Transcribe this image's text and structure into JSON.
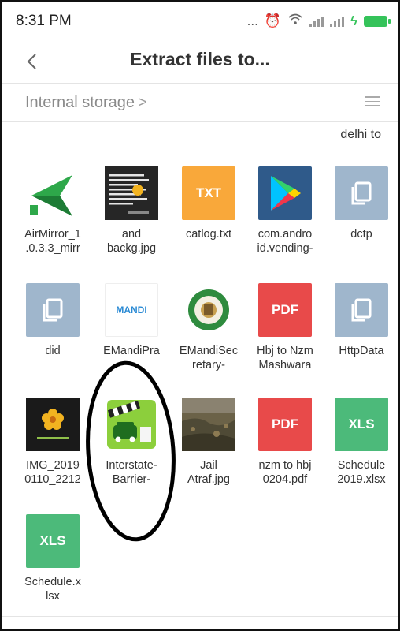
{
  "status": {
    "time": "8:31 PM",
    "dots": "..."
  },
  "header": {
    "title": "Extract files to..."
  },
  "breadcrumb": {
    "location": "Internal storage",
    "separator": ">"
  },
  "partial_label": "delhi to",
  "files": [
    {
      "label_1": "AirMirror_1",
      "label_2": ".0.3.3_mirr",
      "type": "apk",
      "icon": "airmirror-icon"
    },
    {
      "label_1": "and",
      "label_2": "backg.jpg",
      "type": "image",
      "icon": "quote-image-icon"
    },
    {
      "label_1": "catlog.txt",
      "label_2": "",
      "type": "txt",
      "badge": "TXT"
    },
    {
      "label_1": "com.andro",
      "label_2": "id.vending-",
      "type": "apk",
      "icon": "play-store-icon"
    },
    {
      "label_1": "dctp",
      "label_2": "",
      "type": "generic"
    },
    {
      "label_1": "did",
      "label_2": "",
      "type": "generic"
    },
    {
      "label_1": "EMandiPra",
      "label_2": "",
      "type": "image",
      "icon": "mandi-logo-icon",
      "badge": "MANDI"
    },
    {
      "label_1": "EMandiSec",
      "label_2": "retary-",
      "type": "image",
      "icon": "emblem-icon"
    },
    {
      "label_1": "Hbj to Nzm",
      "label_2": "Mashwara",
      "type": "pdf",
      "badge": "PDF"
    },
    {
      "label_1": "HttpData",
      "label_2": "",
      "type": "generic"
    },
    {
      "label_1": "IMG_2019",
      "label_2": "0110_2212",
      "type": "image",
      "icon": "flower-image-icon"
    },
    {
      "label_1": "Interstate-",
      "label_2": "Barrier-",
      "type": "apk",
      "icon": "barrier-app-icon"
    },
    {
      "label_1": "Jail",
      "label_2": "Atraf.jpg",
      "type": "image",
      "icon": "landscape-image-icon"
    },
    {
      "label_1": "nzm to hbj",
      "label_2": "0204.pdf",
      "type": "pdf",
      "badge": "PDF"
    },
    {
      "label_1": "Schedule",
      "label_2": "2019.xlsx",
      "type": "xls",
      "badge": "XLS"
    },
    {
      "label_1": "Schedule.x",
      "label_2": "lsx",
      "type": "xls",
      "badge": "XLS"
    }
  ],
  "colors": {
    "txt": "#f9a83a",
    "pdf": "#e84a4a",
    "xls": "#4cba7a",
    "generic": "#9fb6cc",
    "battery": "#35c35a"
  }
}
